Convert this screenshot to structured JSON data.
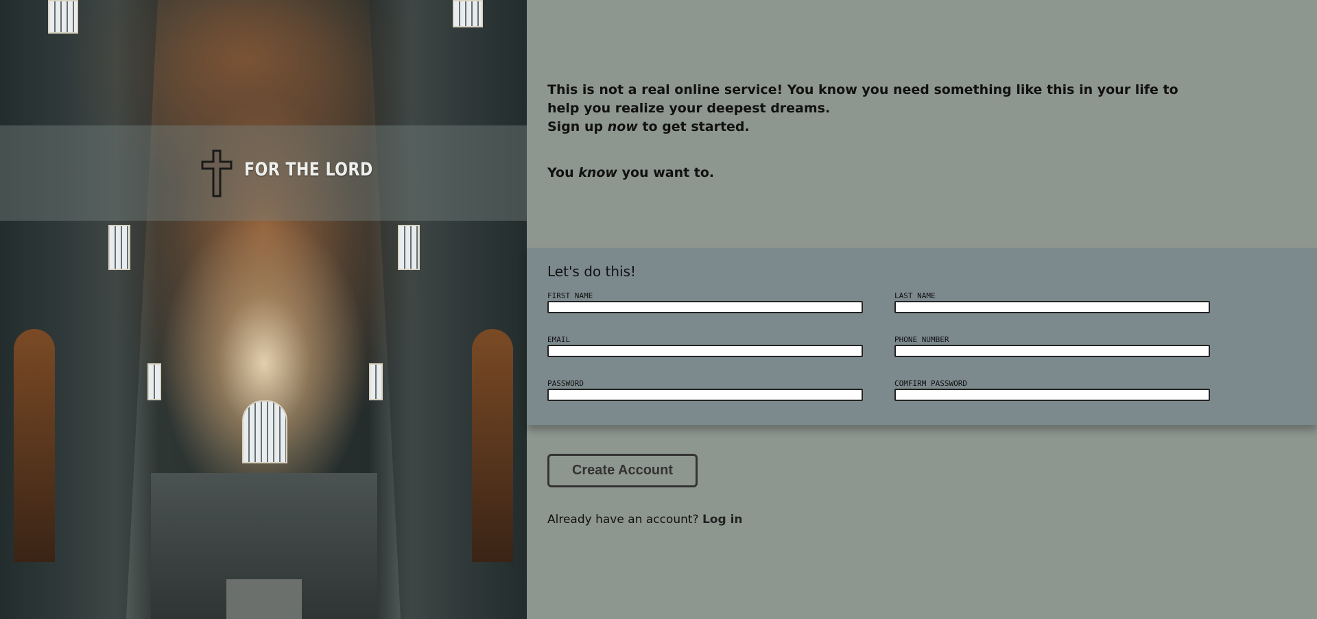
{
  "brand": {
    "name": "FOR THE LORD",
    "logo_icon": "cross-icon"
  },
  "intro": {
    "line1": "This is not a real online service! You know you need something like this in your life to help you realize your deepest dreams.",
    "signup_prefix": "Sign up ",
    "signup_emphasis": "now",
    "signup_suffix": " to get started.",
    "know_prefix": "You ",
    "know_emphasis": "know",
    "know_suffix": " you want to."
  },
  "form": {
    "title": "Let's do this!",
    "fields": {
      "first_name": {
        "label": "FIRST NAME",
        "value": ""
      },
      "last_name": {
        "label": "LAST NAME",
        "value": ""
      },
      "email": {
        "label": "EMAIL",
        "value": ""
      },
      "phone": {
        "label": "PHONE NUMBER",
        "value": ""
      },
      "password": {
        "label": "PASSWORD",
        "value": ""
      },
      "confirm_password": {
        "label": "COMFIRM PASSWORD",
        "value": ""
      }
    }
  },
  "actions": {
    "create_account_label": "Create Account",
    "login_prompt": "Already have an account? ",
    "login_link": "Log in"
  },
  "colors": {
    "page_bg": "#8e9690",
    "form_panel_bg": "#7c898d",
    "text": "#111111",
    "button_border": "#333333"
  }
}
